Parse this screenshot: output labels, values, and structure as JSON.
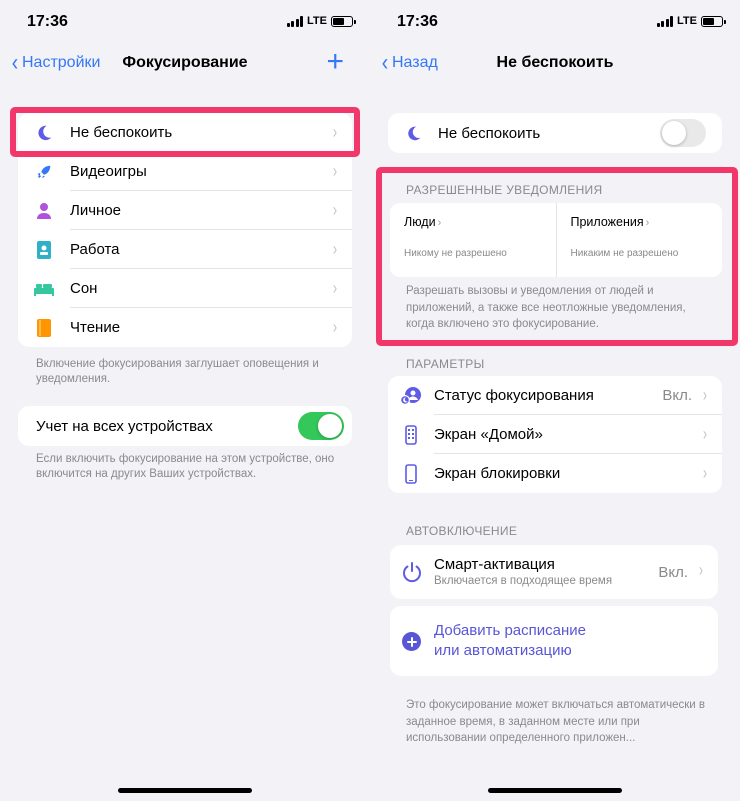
{
  "colors": {
    "accent": "#3478f6",
    "highlight": "#f2386b",
    "toggle_on": "#34c759",
    "toggle_off": "#e9e9ea",
    "purple": "#5856d6"
  },
  "left": {
    "status": {
      "time": "17:36",
      "network": "LTE"
    },
    "nav": {
      "back_label": "Настройки",
      "title": "Фокусирование",
      "add_icon": "+"
    },
    "focus_items": [
      {
        "icon": "moon-icon",
        "label": "Не беспокоить",
        "color": "#5e5ce6"
      },
      {
        "icon": "rocket-icon",
        "label": "Видеоигры",
        "color": "#3478f6"
      },
      {
        "icon": "person-icon",
        "label": "Личное",
        "color": "#af52de"
      },
      {
        "icon": "badge-icon",
        "label": "Работа",
        "color": "#30b0c7"
      },
      {
        "icon": "bed-icon",
        "label": "Сон",
        "color": "#34c7a0"
      },
      {
        "icon": "book-icon",
        "label": "Чтение",
        "color": "#ff9500"
      }
    ],
    "focus_footnote": "Включение фокусирования заглушает оповещения и уведомления.",
    "share_across": {
      "label": "Учет на всех устройствах",
      "enabled": true
    },
    "share_footnote": "Если включить фокусирование на этом устройстве, оно включится на других Ваших устройствах."
  },
  "right": {
    "status": {
      "time": "17:36",
      "network": "LTE"
    },
    "nav": {
      "back_label": "Назад",
      "title": "Не беспокоить"
    },
    "dnd": {
      "label": "Не беспокоить",
      "enabled": false
    },
    "allowed": {
      "header": "РАЗРЕШЕННЫЕ УВЕДОМЛЕНИЯ",
      "people_title": "Люди",
      "people_sub": "Никому не разрешено",
      "apps_title": "Приложения",
      "apps_sub": "Никаким не разрешено",
      "note": "Разрешать вызовы и уведомления от людей и приложений, а также все неотложные уведомления, когда включено это фокусирование."
    },
    "params": {
      "header": "ПАРАМЕТРЫ",
      "items": [
        {
          "icon": "focus-status-icon",
          "label": "Статус фокусирования",
          "value": "Вкл."
        },
        {
          "icon": "home-screen-icon",
          "label": "Экран «Домой»",
          "value": ""
        },
        {
          "icon": "lock-screen-icon",
          "label": "Экран блокировки",
          "value": ""
        }
      ]
    },
    "auto": {
      "header": "АВТОВКЛЮЧЕНИЕ",
      "smart_title": "Смарт-активация",
      "smart_sub": "Включается в подходящее время",
      "smart_value": "Вкл.",
      "add_label_line1": "Добавить расписание",
      "add_label_line2": "или автоматизацию",
      "footnote": "Это фокусирование может включаться автоматически в заданное время, в заданном месте или при использовании определенного приложен..."
    }
  }
}
